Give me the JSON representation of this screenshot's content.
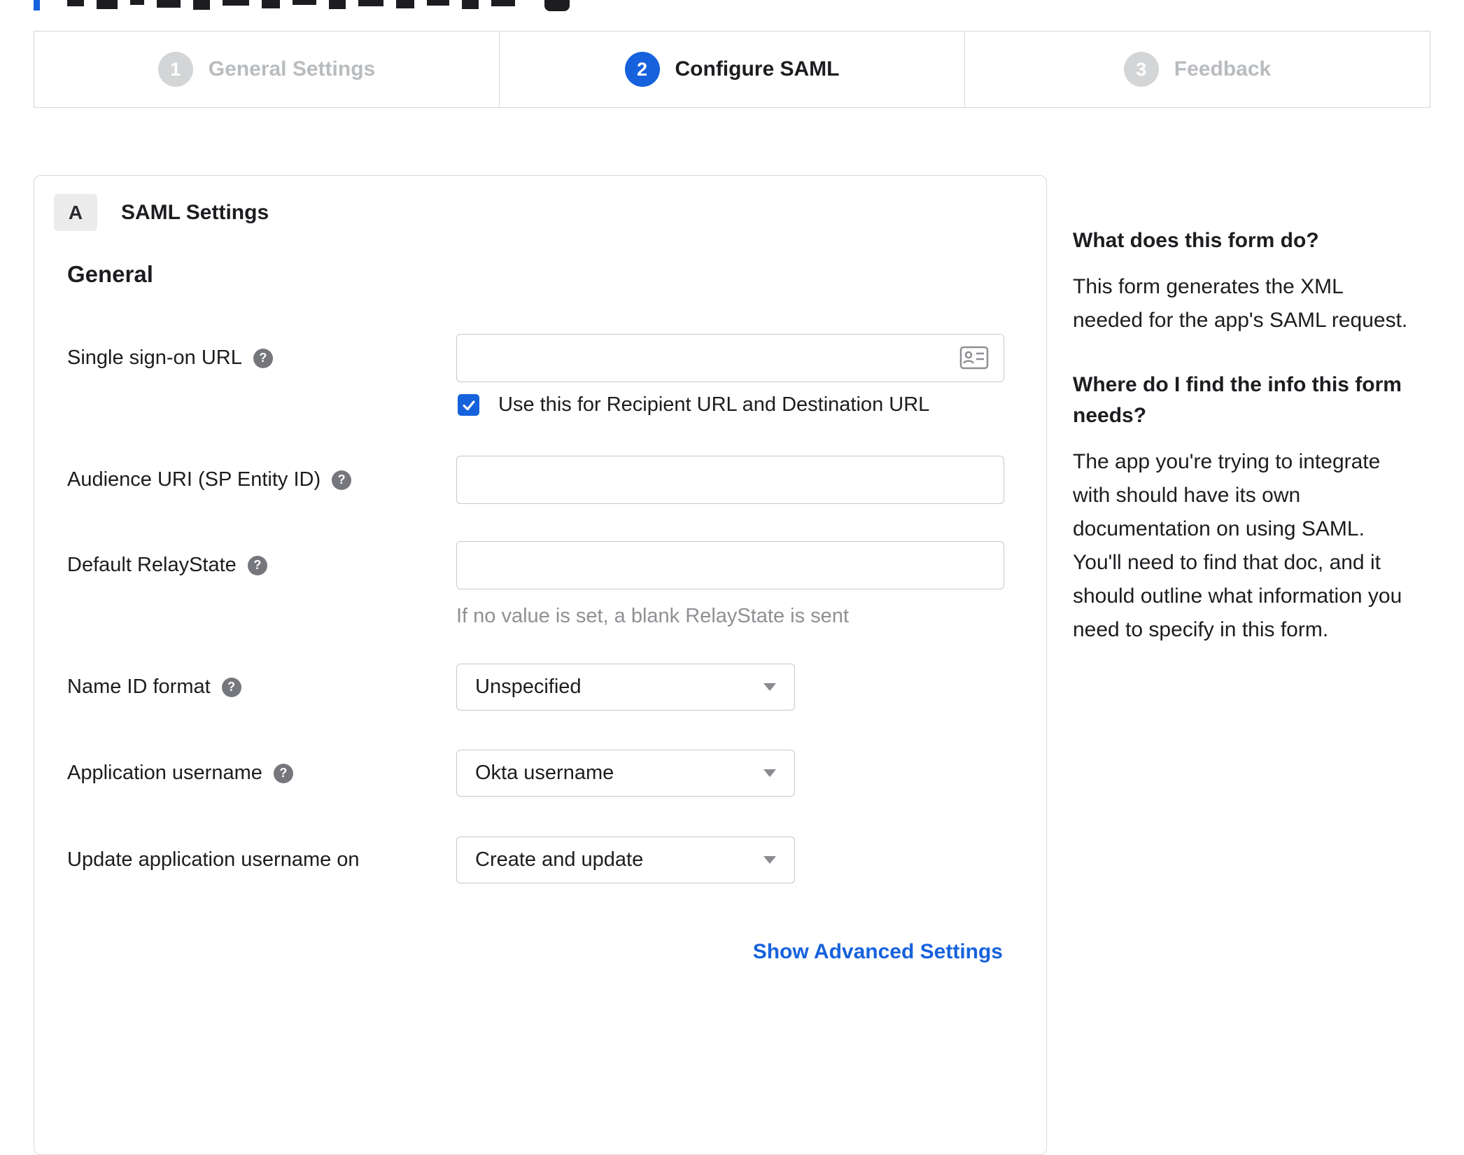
{
  "stepper": {
    "steps": [
      {
        "number": "1",
        "label": "General Settings",
        "state": "inactive"
      },
      {
        "number": "2",
        "label": "Configure SAML",
        "state": "active"
      },
      {
        "number": "3",
        "label": "Feedback",
        "state": "inactive"
      }
    ]
  },
  "panel": {
    "section_badge": "A",
    "section_title": "SAML Settings",
    "group_title": "General",
    "fields": {
      "sso_url": {
        "label": "Single sign-on URL",
        "value": "",
        "checkbox_label": "Use this for Recipient URL and Destination URL",
        "checkbox_checked": true
      },
      "audience_uri": {
        "label": "Audience URI (SP Entity ID)",
        "value": ""
      },
      "default_relaystate": {
        "label": "Default RelayState",
        "value": "",
        "hint": "If no value is set, a blank RelayState is sent"
      },
      "name_id_format": {
        "label": "Name ID format",
        "value": "Unspecified"
      },
      "application_username": {
        "label": "Application username",
        "value": "Okta username"
      },
      "update_app_username": {
        "label": "Update application username on",
        "value": "Create and update"
      }
    },
    "advanced_link": "Show Advanced Settings"
  },
  "sidebar": {
    "q1": "What does this form do?",
    "a1": "This form generates the XML needed for the app's SAML request.",
    "q2": "Where do I find the info this form needs?",
    "a2": "The app you're trying to integrate with should have its own documentation on using SAML. You'll need to find that doc, and it should outline what information you need to specify in this form."
  },
  "icons": {
    "help_glyph": "?"
  },
  "colors": {
    "accent_blue": "#1662dd",
    "inactive_gray": "#b9bcbf",
    "step_circle_gray": "#d3d5d7",
    "border_gray": "#d9d9d9",
    "hint_gray": "#8e9094"
  }
}
